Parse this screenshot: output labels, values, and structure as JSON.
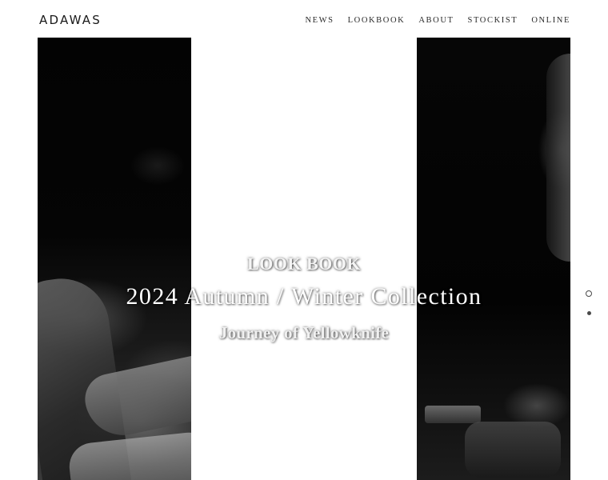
{
  "header": {
    "logo": "ADAWAS",
    "nav": [
      {
        "label": "NEWS"
      },
      {
        "label": "LOOKBOOK"
      },
      {
        "label": "ABOUT"
      },
      {
        "label": "STOCKIST"
      },
      {
        "label": "ONLINE"
      }
    ]
  },
  "hero": {
    "eyebrow": "LOOK BOOK",
    "title": "2024 Autumn / Winter Collection",
    "subtitle": "Journey of Yellowknife"
  },
  "slider": {
    "slide_count": 2,
    "active_index": 0
  },
  "colors": {
    "background": "#ffffff",
    "text_dark": "#1a1a1a",
    "hero_text": "#ffffff",
    "photo_dark": "#050505"
  }
}
